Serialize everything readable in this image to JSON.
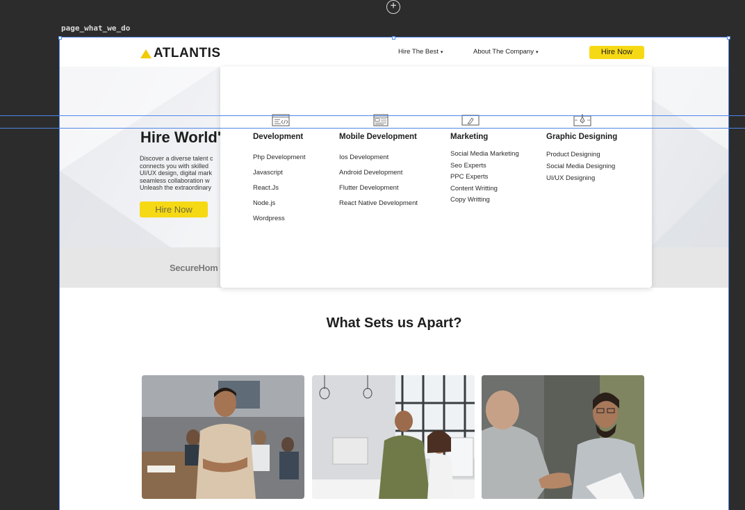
{
  "editor": {
    "frame_label": "page_what_we_do",
    "add_icon": "plus-circle-icon"
  },
  "header": {
    "logo_text": "ATLANTIS",
    "nav": [
      {
        "label": "Hire The Best",
        "caret": "▾"
      },
      {
        "label": "About The Company",
        "caret": "▾"
      }
    ],
    "cta": "Hire Now"
  },
  "hero": {
    "title": "Hire World'",
    "description_lines": [
      "Discover a diverse talent c",
      "connects you with skilled",
      "UI/UX design, digital mark",
      "seamless collaboration w",
      "Unleash the extraordinary"
    ],
    "cta": "Hire Now"
  },
  "partners": {
    "first_logo": "SecureHom"
  },
  "mega_menu": {
    "categories": [
      {
        "title": "Development",
        "icon": "code-window-icon",
        "items": [
          "Php Development",
          "Javascript",
          "React.Js",
          "Node.js",
          "Wordpress"
        ]
      },
      {
        "title": "Mobile Development",
        "icon": "app-layout-icon",
        "items": [
          "Ios Development",
          "Android Development",
          "Flutter Development",
          "React Native Development"
        ]
      },
      {
        "title": "Marketing",
        "icon": "pen-board-icon",
        "items": [
          "Social Media Marketing",
          "Seo Experts",
          "PPC Experts",
          "Content Writting",
          "Copy Writting"
        ]
      },
      {
        "title": "Graphic Designing",
        "icon": "pen-tool-icon",
        "items": [
          "Product Designing",
          "Social Media Designing",
          "UI/UX Designing"
        ]
      }
    ]
  },
  "features": {
    "title": "What Sets us Apart?",
    "images": [
      "office-team-photo",
      "coworkers-at-desk-photo",
      "handshake-photo"
    ]
  },
  "colors": {
    "accent": "#f6d915",
    "logo_triangle": "#f2cb05",
    "guide": "#4f86e8",
    "canvas": "#2c2c2c"
  }
}
